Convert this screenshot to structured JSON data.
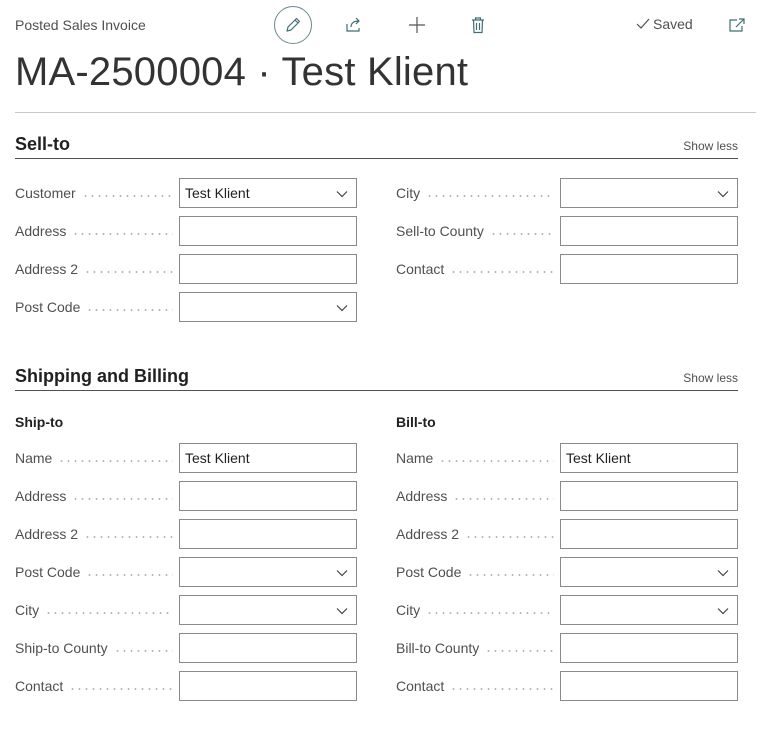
{
  "header": {
    "caption": "Posted Sales Invoice",
    "saved_label": "Saved",
    "title": "MA-2500004 · Test Klient"
  },
  "sell_to": {
    "title": "Sell-to",
    "show_less": "Show less",
    "customer": {
      "label": "Customer",
      "value": "Test Klient"
    },
    "address": {
      "label": "Address",
      "value": ""
    },
    "address2": {
      "label": "Address 2",
      "value": ""
    },
    "post_code": {
      "label": "Post Code",
      "value": ""
    },
    "city": {
      "label": "City",
      "value": ""
    },
    "county": {
      "label": "Sell-to County",
      "value": ""
    },
    "contact": {
      "label": "Contact",
      "value": ""
    }
  },
  "shipping": {
    "title": "Shipping and Billing",
    "show_less": "Show less",
    "ship_to": {
      "heading": "Ship-to",
      "name": {
        "label": "Name",
        "value": "Test Klient"
      },
      "address": {
        "label": "Address",
        "value": ""
      },
      "address2": {
        "label": "Address 2",
        "value": ""
      },
      "post_code": {
        "label": "Post Code",
        "value": ""
      },
      "city": {
        "label": "City",
        "value": ""
      },
      "county": {
        "label": "Ship-to County",
        "value": ""
      },
      "contact": {
        "label": "Contact",
        "value": ""
      }
    },
    "bill_to": {
      "heading": "Bill-to",
      "name": {
        "label": "Name",
        "value": "Test Klient"
      },
      "address": {
        "label": "Address",
        "value": ""
      },
      "address2": {
        "label": "Address 2",
        "value": ""
      },
      "post_code": {
        "label": "Post Code",
        "value": ""
      },
      "city": {
        "label": "City",
        "value": ""
      },
      "county": {
        "label": "Bill-to County",
        "value": ""
      },
      "contact": {
        "label": "Contact",
        "value": ""
      }
    }
  }
}
